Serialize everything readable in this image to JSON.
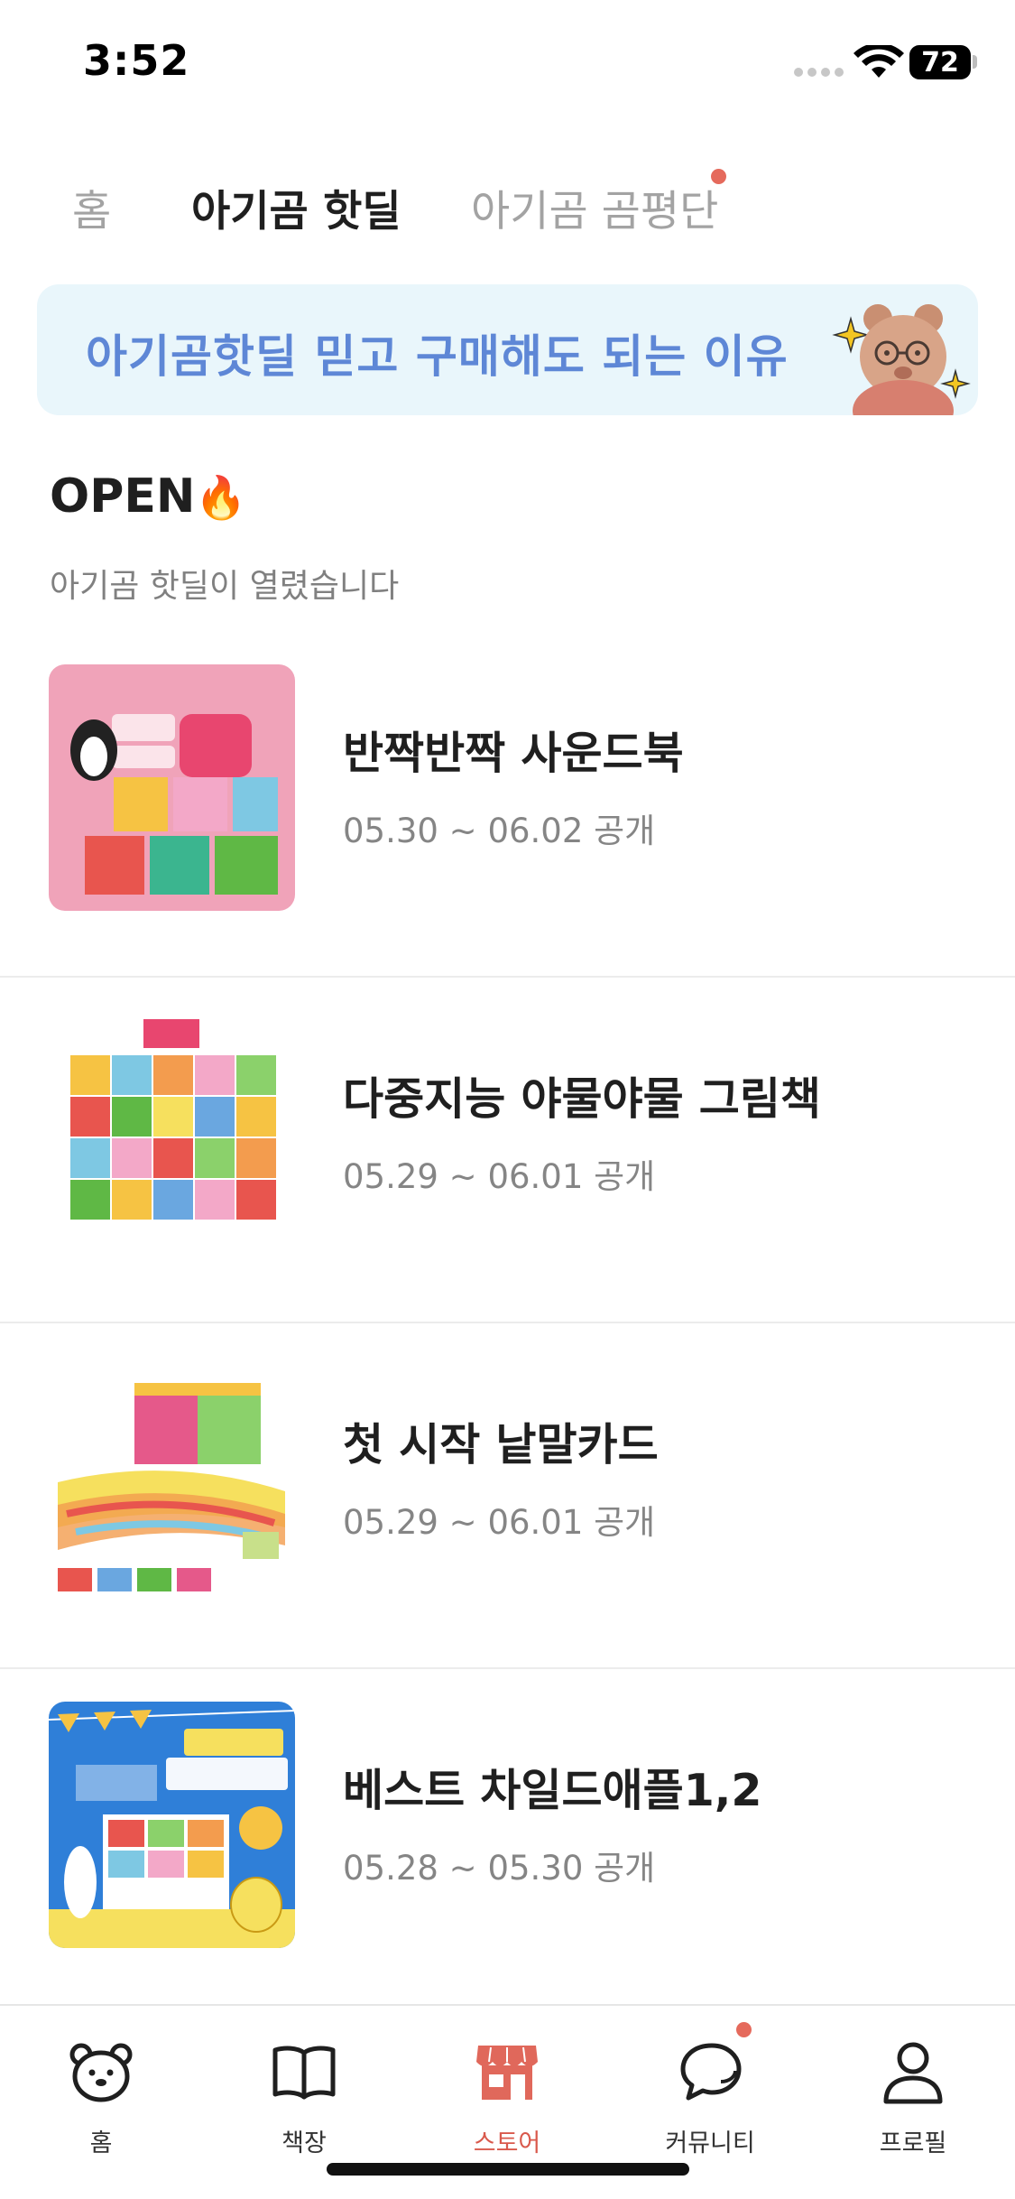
{
  "status_bar": {
    "time": "3:52",
    "battery": "72"
  },
  "top_tabs": [
    {
      "label": "홈"
    },
    {
      "label": "아기곰 핫딜"
    },
    {
      "label": "아기곰 곰평단"
    }
  ],
  "active_top_tab": "아기곰 핫딜",
  "banner": {
    "text": "아기곰핫딜 믿고 구매해도 되는 이유"
  },
  "section": {
    "title": "OPEN",
    "subtitle": "아기곰 핫딜이 열렸습니다"
  },
  "products": [
    {
      "title": "반짝반짝 사운드북",
      "date": "05.30 ~ 06.02 공개"
    },
    {
      "title": "다중지능 야물야물 그림책",
      "date": "05.29 ~ 06.01 공개"
    },
    {
      "title": "첫 시작 낱말카드",
      "date": "05.29 ~ 06.01 공개"
    },
    {
      "title": "베스트 차일드애플1,2",
      "date": "05.28 ~ 05.30 공개"
    }
  ],
  "bottom_nav": [
    {
      "label": "홈",
      "icon": "bear-icon"
    },
    {
      "label": "책장",
      "icon": "book-icon"
    },
    {
      "label": "스토어",
      "icon": "store-icon"
    },
    {
      "label": "커뮤니티",
      "icon": "chat-icon"
    },
    {
      "label": "프로필",
      "icon": "profile-icon"
    }
  ],
  "active_nav": "스토어",
  "colors": {
    "accent": "#d9594c",
    "banner_bg": "#e9f6fb",
    "banner_text": "#5e87d6",
    "badge": "#e56a5c"
  }
}
